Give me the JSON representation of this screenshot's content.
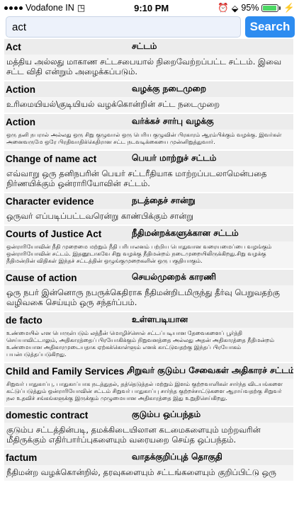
{
  "status_bar": {
    "carrier": "Vodafone IN",
    "time": "9:10 PM",
    "battery": "95%",
    "battery_level": 0.95,
    "icons": [
      "signal-icon",
      "wifi-icon",
      "alarm-icon",
      "bluetooth-icon",
      "battery-icon",
      "charging-icon"
    ]
  },
  "search": {
    "value": "act",
    "button_label": "Search",
    "accent": "#2d8cf0"
  },
  "results": [
    {
      "term": "Act",
      "tamil": "சட்டம்",
      "definition": "மத்திய அல்லது மாகாண சட்டசபையால் நிறைவேற்றப்பட்ட சட்டம். இவை சட்ட விதி என்றும் அழைக்கப்படும்.",
      "small": false
    },
    {
      "term": "Action",
      "tamil": "வழக்கு நடைமுறை",
      "definition": "உரிமையியல்\\குடியியல் வழக்கொன்றின் சட்ட நடைமுறை",
      "small": false
    },
    {
      "term": "Action",
      "tamil": "வர்க்கச் சார்பு வழக்கு",
      "definition": "ஒரு தனி நபரால் அல்லது ஒரு சிறு குழுவால் ஒரு பெரிய குழுவின் பிரகாரம் ஆரம்பிக்கும் வழக்கு. இவர்கள் அனைவருமே ஒரே பிரதிவாதிக்கெதிரான சட்ட நடவடிக்கையை முன்னிறுத்துவார்.",
      "small": true
    },
    {
      "term": "Change of name act",
      "tamil": "பெயர் மாற்றுச் சட்டம்",
      "definition": "எவ்வாறு ஒரு தனிநபரின் பெயர் சட்டரீதியாக மாற்றப்படலாமென்பதை நிர்ணயிக்கும் ஒன்ராரியோவின் சட்டம்.",
      "small": false
    },
    {
      "term": "Character evidence",
      "tamil": "நடத்தைச் சான்று",
      "definition": "ஒருவர் எப்படிப்பட்டவரென்று காண்பிக்கும் சான்று",
      "small": false
    },
    {
      "term": "Courts of Justice Act",
      "tamil": "நீதிமன்றக்களுக்கான சட்டம்",
      "definition": "ஒன்ராரியோவின் நீதி முறைமை மற்றும் நீதி பரிபாலனம் பற்றிய பொதுவான வரையமைப்பை வழங்கும் ஒன்ராரியோவின் சட்டம். இதனூடாகவே சிறு வழக்கு நீதிமன்றம் நடைமுறையிலிருக்கிறது.சிறு வழக்கு நீதிமன்றின் விதிகள் இந்தச் சட்டத்தின் ஒழுங்குமுறைகளின் ஒரு பகுதியாகும்.",
      "small": true
    },
    {
      "term": "Cause of action",
      "tamil": "செயல்முறைக் காரணி",
      "definition": "ஒரு நபர் இன்னொரு நபருக்கெதிராக நீதிமன்றிடமிருந்து தீர்வு பெறுவதற்கு வழிவகை செய்யும் ஒரு சந்தர்ப்பம்.",
      "small": false
    },
    {
      "term": "de facto",
      "tamil": "உள்ளபடியான",
      "definition": "உண்மையில் என பொருள்படும் லத்தீன் மொழிச்சொல் சட்டப்படியான தேவைகளைப் பூர்த்தி செய்யாவிட்டாலும், அதிகாரத்தைப் பிரயோகிக்கும் நிறுவனத்தை அல்லது அதன் அதிகாரத்தை நீதிமன்றம் உண்மையான அதிகாரமுடையதாக ஏற்கக்கொள்ளும் எனக் காட்டுவதற்கு இந்தப் பிரயோகம் பயன்படுத்தப்படுகிறது.",
      "small": true
    },
    {
      "term": "Child and Family Services Act",
      "tamil": "சிறுவர் குடும்ப சேவைகள் அதிகாரச் சட்டம்.",
      "definition": "சிறுவர் பாதுகாப்பு, பாதுகாப்பாக நடத்துதல், தத்தெடுத்தல் மற்றும் இளம் குற்றவாளிகள் சார்ந்த விடயங்களை கட்டுப்படுத்தும் ஒன்ராரியோவின் சட்டம் சிறுவர் பாதுகாப்பு சார்ந்த குற்றச்சாட்டுகளை ஆராய்வதற்கு சிறுவர் நல உதவிச் சங்கங்களுக்கு இருக்கும் முழுமையான அதிகாரத்தை இது உறுதிசெய்கிறது.",
      "small": true
    },
    {
      "term": "domestic contract",
      "tamil": "குடும்ப ஒப்பந்தம்",
      "definition": "குடும்ப சட்டத்தின்படி, தமக்கிடையிலான கடமைகளையும் மற்றவரின் மீதிருக்கும் எதிர்பார்ப்புகளையும் வரையறை செய்த ஒப்பந்தம்.",
      "small": false
    },
    {
      "term": "factum",
      "tamil": "வாதக்குறிப்புத் தொகுதி",
      "definition": "நீதிமன்ற வழக்கொன்றில், தரவுகளையும் சட்டங்களையும் குறிப்பிட்டு ஒரு",
      "small": false
    }
  ]
}
